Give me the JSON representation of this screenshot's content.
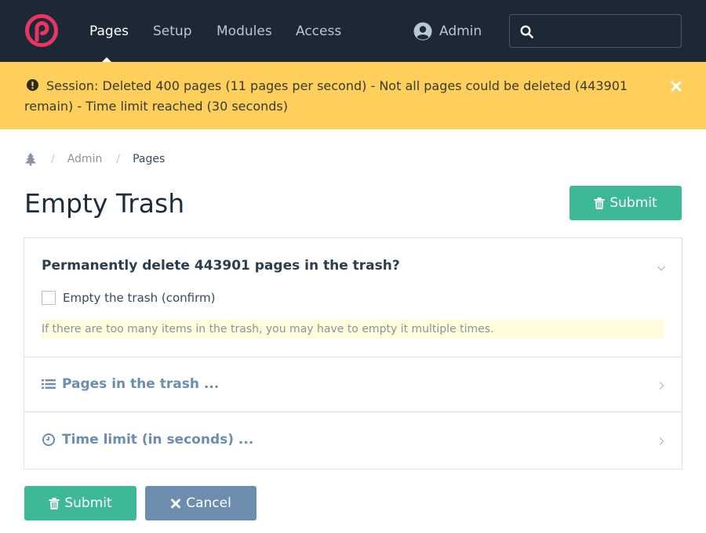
{
  "nav": {
    "logo": "processwire-logo",
    "items": [
      {
        "label": "Pages",
        "active": true
      },
      {
        "label": "Setup",
        "active": false
      },
      {
        "label": "Modules",
        "active": false
      },
      {
        "label": "Access",
        "active": false
      }
    ],
    "user": "Admin",
    "search_value": ""
  },
  "notice": {
    "icon": "exclamation-circle-icon",
    "text": "Session: Deleted 400 pages (11 pages per second) - Not all pages could be deleted (443901 remain) - Time limit reached (30 seconds)",
    "color": "#fecf5b"
  },
  "breadcrumb": {
    "icon": "tree-icon",
    "items": [
      "Admin",
      "Pages"
    ]
  },
  "page": {
    "title": "Empty Trash",
    "submit_label": "Submit"
  },
  "panels": {
    "confirm": {
      "title": "Permanently delete 443901 pages in the trash?",
      "checkbox_label": "Empty the trash (confirm)",
      "checked": false,
      "hint": "If there are too many items in the trash, you may have to empty it multiple times."
    },
    "pages": {
      "title": "Pages in the trash ...",
      "icon": "list-icon"
    },
    "time": {
      "title": "Time limit (in seconds) ...",
      "icon": "clock-icon"
    }
  },
  "footer": {
    "submit_label": "Submit",
    "cancel_label": "Cancel"
  },
  "colors": {
    "nav_bg": "#1c2836",
    "accent": "#3eb998",
    "secondary": "#6c8dae",
    "brand": "#e83561"
  }
}
